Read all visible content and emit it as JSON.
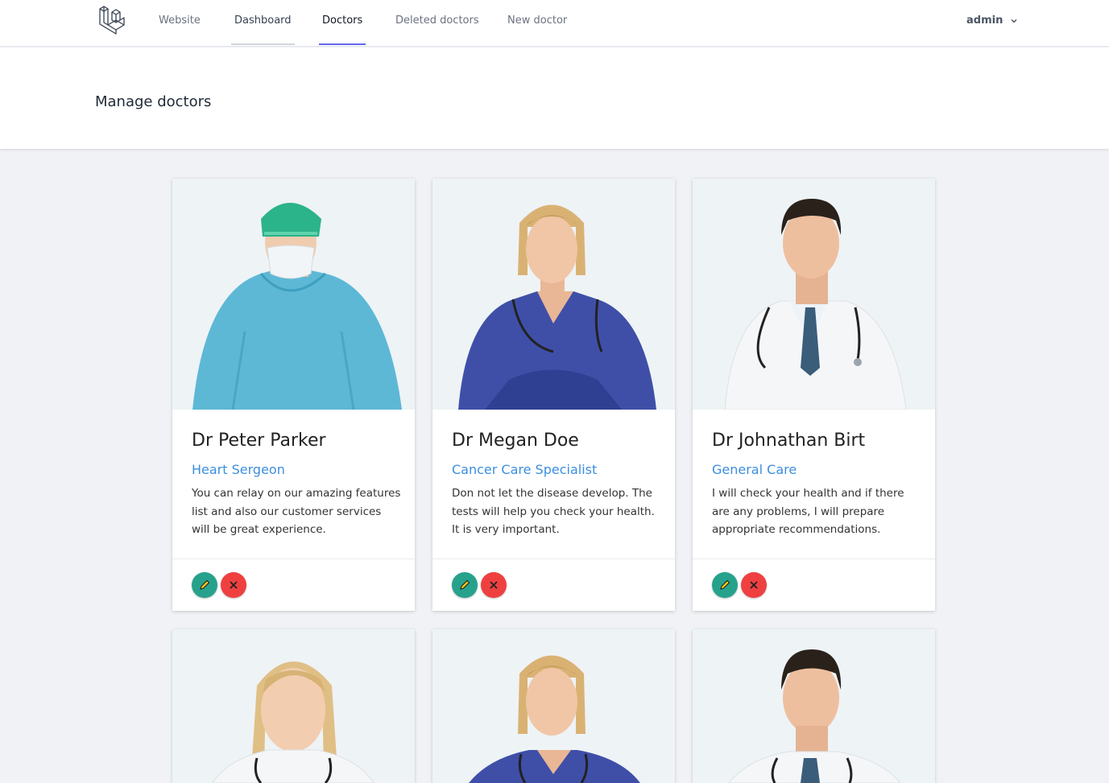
{
  "nav": {
    "links": [
      {
        "label": "Website"
      },
      {
        "label": "Dashboard"
      },
      {
        "label": "Doctors"
      },
      {
        "label": "Deleted doctors"
      },
      {
        "label": "New doctor"
      }
    ],
    "user": "admin"
  },
  "header": {
    "title": "Manage doctors"
  },
  "colors": {
    "accent": "#6366f1",
    "specialty": "#3b8ee0",
    "edit": "#26a28c",
    "delete": "#ef4040"
  },
  "doctors": [
    {
      "name": "Dr Peter Parker",
      "specialty": "Heart Sergeon",
      "description": "You can relay on our amazing features list and also our customer services will be great experience."
    },
    {
      "name": "Dr Megan Doe",
      "specialty": "Cancer Care Specialist",
      "description": "Don not let the disease develop. The tests will help you check your health. It is very important."
    },
    {
      "name": "Dr Johnathan Birt",
      "specialty": "General Care",
      "description": "I will check your health and if there are any problems, I will prepare appropriate recommendations."
    },
    {},
    {},
    {}
  ],
  "icons": {
    "logo": "laravel-logo-icon",
    "chevron": "chevron-down-icon",
    "edit": "pencil-icon",
    "delete": "x-icon"
  }
}
